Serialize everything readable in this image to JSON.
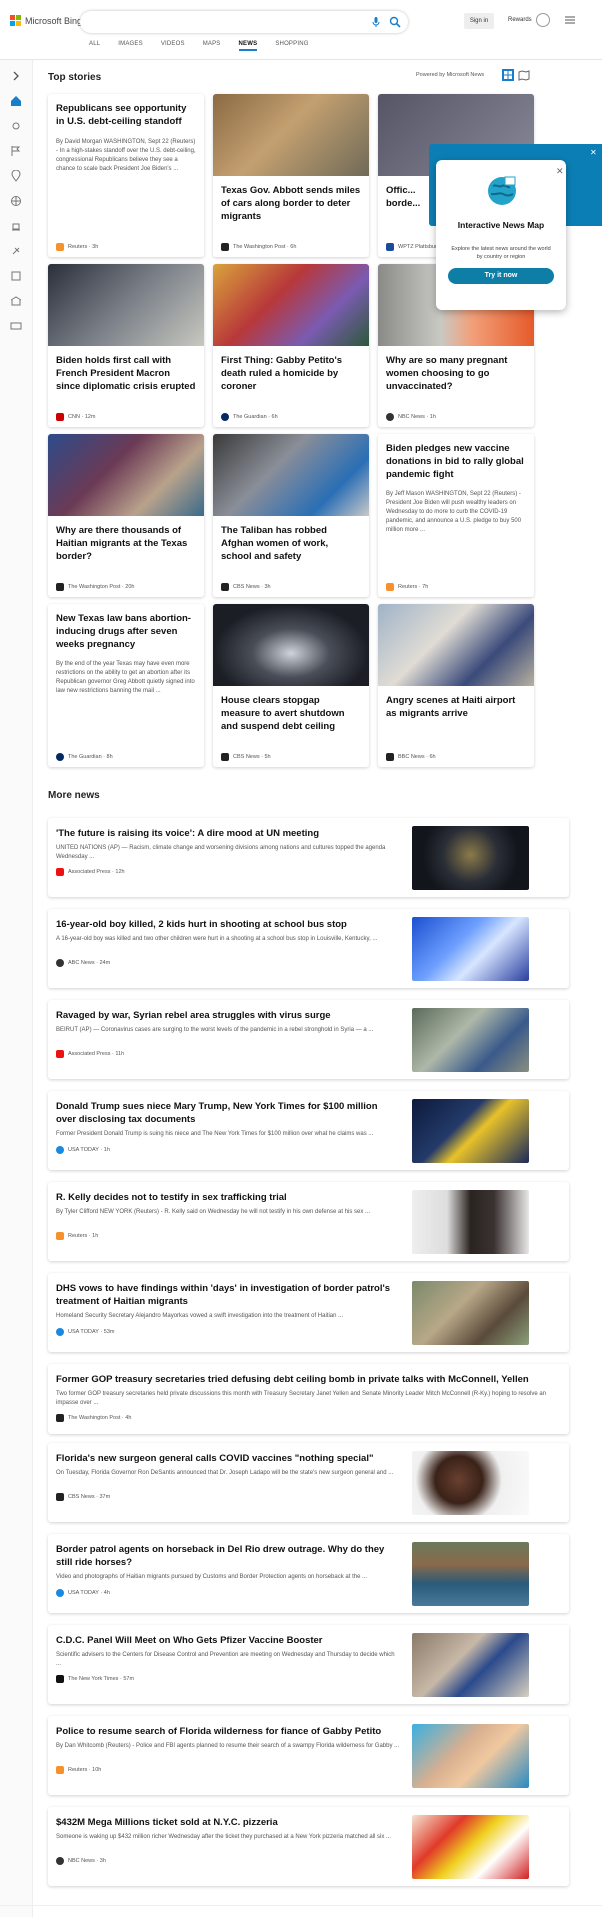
{
  "header": {
    "logo_text": "Microsoft Bing",
    "search_value": "",
    "nav": [
      "ALL",
      "IMAGES",
      "VIDEOS",
      "MAPS",
      "NEWS",
      "SHOPPING"
    ],
    "active_nav": "NEWS",
    "signin_label": "Sign in",
    "rewards_label": "Rewards"
  },
  "top_stories": {
    "heading": "Top stories",
    "powered_by": "Powered by Microsoft News",
    "cards": [
      {
        "title": "Republicans see opportunity in U.S. debt-ceiling standoff",
        "desc": "By David Morgan WASHINGTON, Sept 22 (Reuters) - In a high-stakes standoff over the U.S. debt-ceiling, congressional Republicans believe they see a chance to scale back President Joe Biden's ...",
        "source": "Reuters",
        "time": "3h"
      },
      {
        "title": "Texas Gov. Abbott sends miles of cars along border to deter migrants",
        "desc": "",
        "source": "The Washington Post",
        "time": "6h"
      },
      {
        "title": "Offic... borde...",
        "desc": "",
        "source": "WPTZ Plattsburgh-Burlington",
        "time": "2h"
      },
      {
        "title": "Biden holds first call with French President Macron since diplomatic crisis erupted",
        "desc": "",
        "source": "CNN",
        "time": "12m"
      },
      {
        "title": "First Thing: Gabby Petito's death ruled a homicide by coroner",
        "desc": "",
        "source": "The Guardian",
        "time": "6h"
      },
      {
        "title": "Why are so many pregnant women choosing to go unvaccinated?",
        "desc": "",
        "source": "NBC News",
        "time": "1h"
      },
      {
        "title": "Why are there thousands of Haitian migrants at the Texas border?",
        "desc": "",
        "source": "The Washington Post",
        "time": "20h"
      },
      {
        "title": "The Taliban has robbed Afghan women of work, school and safety",
        "desc": "",
        "source": "CBS News",
        "time": "3h"
      },
      {
        "title": "Biden pledges new vaccine donations in bid to rally global pandemic fight",
        "desc": "By Jeff Mason WASHINGTON, Sept 22 (Reuters) - President Joe Biden will push wealthy leaders on Wednesday to do more to curb the COVID-19 pandemic, and announce a U.S. pledge to buy 500 million more ...",
        "source": "Reuters",
        "time": "7h"
      },
      {
        "title": "New Texas law bans abortion-inducing drugs after seven weeks pregnancy",
        "desc": "By the end of the year Texas may have even more restrictions on the ability to get an abortion after its Republican governor Greg Abbott quietly signed into law new restrictions banning the mail ...",
        "source": "The Guardian",
        "time": "8h"
      },
      {
        "title": "House clears stopgap measure to avert shutdown and suspend debt ceiling",
        "desc": "",
        "source": "CBS News",
        "time": "5h"
      },
      {
        "title": "Angry scenes at Haiti airport as migrants arrive",
        "desc": "",
        "source": "BBC News",
        "time": "6h"
      }
    ]
  },
  "popup": {
    "title": "Interactive News Map",
    "desc": "Explore the latest news around the world by country or region",
    "button": "Try it now"
  },
  "more_news": {
    "heading": "More news",
    "items": [
      {
        "title": "'The future is raising its voice': A dire mood at UN meeting",
        "desc": "UNITED NATIONS (AP) — Racism, climate change and worsening divisions among nations and cultures topped the agenda Wednesday ...",
        "source": "Associated Press",
        "time": "12h"
      },
      {
        "title": "16-year-old boy killed, 2 kids hurt in shooting at school bus stop",
        "desc": "A 16-year-old boy was killed and two other children were hurt in a shooting at a school bus stop in Louisville, Kentucky, ...",
        "source": "ABC News",
        "time": "24m"
      },
      {
        "title": "Ravaged by war, Syrian rebel area struggles with virus surge",
        "desc": "BEIRUT (AP) — Coronavirus cases are surging to the worst levels of the pandemic in a rebel stronghold in Syria — a ...",
        "source": "Associated Press",
        "time": "11h"
      },
      {
        "title": "Donald Trump sues niece Mary Trump, New York Times for $100 million over disclosing tax documents",
        "desc": "Former President Donald Trump is suing his niece and The New York Times for $100 million over what he claims was ...",
        "source": "USA TODAY",
        "time": "1h"
      },
      {
        "title": "R. Kelly decides not to testify in sex trafficking trial",
        "desc": "By Tyler Clifford NEW YORK (Reuters) - R. Kelly said on Wednesday he will not testify in his own defense at his sex ...",
        "source": "Reuters",
        "time": "1h"
      },
      {
        "title": "DHS vows to have findings within 'days' in investigation of border patrol's treatment of Haitian migrants",
        "desc": "Homeland Security Secretary Alejandro Mayorkas vowed a swift investigation into the treatment of Haitian ...",
        "source": "USA TODAY",
        "time": "53m"
      },
      {
        "title": "Former GOP treasury secretaries tried defusing debt ceiling bomb in private talks with McConnell, Yellen",
        "desc": "Two former GOP treasury secretaries held private discussions this month with Treasury Secretary Janet Yellen and Senate Minority Leader Mitch McConnell (R-Ky.) hoping to resolve an impasse over ...",
        "source": "The Washington Post",
        "time": "4h"
      },
      {
        "title": "Florida's new surgeon general calls COVID vaccines \"nothing special\"",
        "desc": "On Tuesday, Florida Governor Ron DeSantis announced that Dr. Joseph Ladapo will be the state's new surgeon general and ...",
        "source": "CBS News",
        "time": "37m"
      },
      {
        "title": "Border patrol agents on horseback in Del Rio drew outrage. Why do they still ride horses?",
        "desc": "Video and photographs of Haitian migrants pursued by Customs and Border Protection agents on horseback at the ...",
        "source": "USA TODAY",
        "time": "4h"
      },
      {
        "title": "C.D.C. Panel Will Meet on Who Gets Pfizer Vaccine Booster",
        "desc": "Scientific advisers to the Centers for Disease Control and Prevention are meeting on Wednesday and Thursday to decide which ...",
        "source": "The New York Times",
        "time": "57m"
      },
      {
        "title": "Police to resume search of Florida wilderness for fiance of Gabby Petito",
        "desc": "By Dan Whitcomb (Reuters) - Police and FBI agents planned to resume their search of a swampy Florida wilderness for Gabby ...",
        "source": "Reuters",
        "time": "10h"
      },
      {
        "title": "$432M Mega Millions ticket sold at N.Y.C. pizzeria",
        "desc": "Someone is waking up $432 million richer Wednesday after the ticket they purchased at a New York pizzeria matched all six ...",
        "source": "NBC News",
        "time": "3h"
      }
    ]
  },
  "colors": {
    "accent": "#177ec9",
    "popup_btn": "#0f7ea6"
  }
}
